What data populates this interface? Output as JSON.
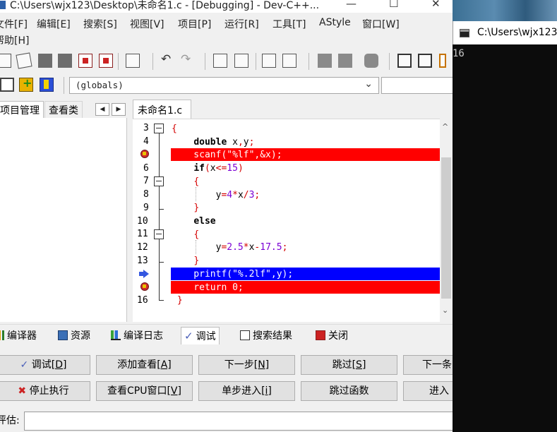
{
  "window": {
    "title": "C:\\Users\\wjx123\\Desktop\\未命名1.c - [Debugging] - Dev-C++...",
    "min_btn": "—",
    "max_btn": "☐",
    "close_btn": "✕"
  },
  "menu": {
    "row1": [
      "文件[F]",
      "编辑[E]",
      "搜索[S]",
      "视图[V]",
      "项目[P]",
      "运行[R]",
      "工具[T]",
      "AStyle",
      "窗口[W]"
    ],
    "row2": [
      "帮助[H]"
    ]
  },
  "toolbar2": {
    "scope_value": "(globals)",
    "arrow": "⌄"
  },
  "left_panel": {
    "tabs": [
      "项目管理",
      "查看类"
    ],
    "scroll_left": "◀",
    "scroll_right": "▶"
  },
  "editor": {
    "tab_label": "未命名1.c",
    "line_numbers": [
      "3",
      "4",
      "5",
      "6",
      "7",
      "8",
      "9",
      "10",
      "11",
      "12",
      "13",
      "14",
      "15",
      "16"
    ],
    "scroll_up": "^",
    "scroll_down": "⌄"
  },
  "bottom_tabs": [
    {
      "label": "编译器",
      "icon": "compiler-icon"
    },
    {
      "label": "资源",
      "icon": "resources-icon"
    },
    {
      "label": "编译日志",
      "icon": "compile-log-icon"
    },
    {
      "label": "调试",
      "icon": "debug-check-icon"
    },
    {
      "label": "搜索结果",
      "icon": "search-results-icon"
    },
    {
      "label": "关闭",
      "icon": "close-icon"
    }
  ],
  "debug": {
    "buttons_row1": [
      {
        "prefix": "✓ ",
        "text": "调试",
        "key": "[D]"
      },
      {
        "prefix": "",
        "text": "添加查看",
        "key": "[A]"
      },
      {
        "prefix": "",
        "text": "下一步",
        "key": "[N]"
      },
      {
        "prefix": "",
        "text": "跳过",
        "key": "[S]"
      },
      {
        "prefix": "",
        "text": "下一条",
        "key": ""
      }
    ],
    "buttons_row2": [
      {
        "prefix": "✖ ",
        "text": "停止执行",
        "key": ""
      },
      {
        "prefix": "",
        "text": "查看CPU窗口",
        "key": "[V]"
      },
      {
        "prefix": "",
        "text": "单步进入",
        "key": "[i]"
      },
      {
        "prefix": "",
        "text": "跳过函数",
        "key": ""
      },
      {
        "prefix": "",
        "text": "进入",
        "key": ""
      }
    ],
    "eval_label": "评估:",
    "eval_value": ""
  },
  "console": {
    "title": "C:\\Users\\wjx123",
    "output": "16"
  },
  "colors": {
    "breakpoint_line": "#ff0000",
    "exec_line": "#0000ff",
    "console_bg": "#0c0c0c"
  }
}
